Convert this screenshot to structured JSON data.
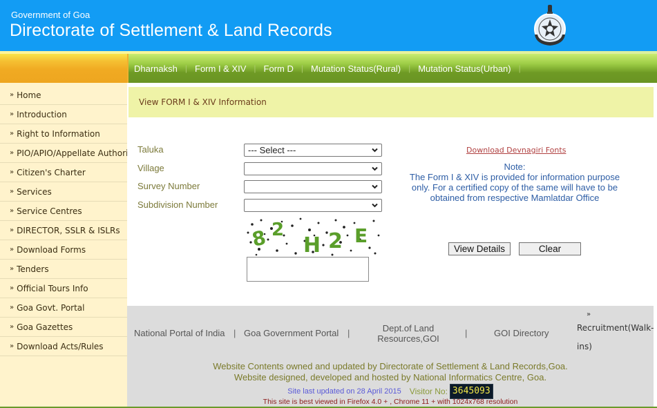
{
  "header": {
    "gov_label": "Government of Goa",
    "title": "Directorate of Settlement & Land Records",
    "emblem_icon": "goa-government-emblem",
    "bg_color": "#129cf4"
  },
  "nav": {
    "items": [
      {
        "label": "Dharnaksh"
      },
      {
        "label": "Form I & XIV"
      },
      {
        "label": "Form D"
      },
      {
        "label": "Mutation Status(Rural)"
      },
      {
        "label": "Mutation Status(Urban)"
      }
    ],
    "separator": "|",
    "bg_color": "#6e9a24",
    "accent_left": "#f0aa22"
  },
  "sidebar": {
    "bullet": "»",
    "items": [
      {
        "label": "Home"
      },
      {
        "label": "Introduction"
      },
      {
        "label": "Right to Information"
      },
      {
        "label": "PIO/APIO/Appellate Authority"
      },
      {
        "label": "Citizen's Charter"
      },
      {
        "label": "Services"
      },
      {
        "label": "Service Centres"
      },
      {
        "label": "DIRECTOR, SSLR & ISLRs"
      },
      {
        "label": "Download Forms"
      },
      {
        "label": "Tenders"
      },
      {
        "label": "Official Tours Info"
      },
      {
        "label": "Goa Govt. Portal"
      },
      {
        "label": "Goa Gazettes"
      },
      {
        "label": "Download Acts/Rules"
      }
    ],
    "bg_color": "#fff3cc"
  },
  "main": {
    "section_title": "View FORM I & XIV Information",
    "form": {
      "taluka_label": "Taluka",
      "taluka_value": "--- Select ---",
      "village_label": "Village",
      "village_value": "",
      "survey_label": "Survey Number",
      "survey_value": "",
      "subdivision_label": "Subdivision Number",
      "subdivision_value": "",
      "captcha_text": "82H2E",
      "captcha_input_value": ""
    },
    "font_link": "Download Devnagiri Fonts",
    "note_title": "Note:",
    "note_text": "The Form I & XIV is provided for information purpose only. For a certified copy of the same will have to be obtained from respective Mamlatdar Office",
    "view_button": "View Details",
    "clear_button": "Clear"
  },
  "footer": {
    "links": {
      "national_portal": "National Portal of India",
      "goa_portal": "Goa Government Portal",
      "dept_land": "Dept.of Land Resources,GOI",
      "goi_directory": "GOI Directory",
      "recruitment": "Recruitment(Walk-ins)"
    },
    "separator": "|",
    "owned_line": "Website Contents owned and updated by Directorate of Settlement & Land Records,Goa.",
    "designed_line": "Website designed, developed and hosted by National Informatics Centre, Goa.",
    "last_updated": "Site last updated on 28 April 2015",
    "visitor_label": "Visitor No:",
    "visitor_count": "3645093",
    "best_viewed": "This site is best viewed in Firefox 4.0 + , Chrome 11 + with 1024x768 resolution"
  }
}
